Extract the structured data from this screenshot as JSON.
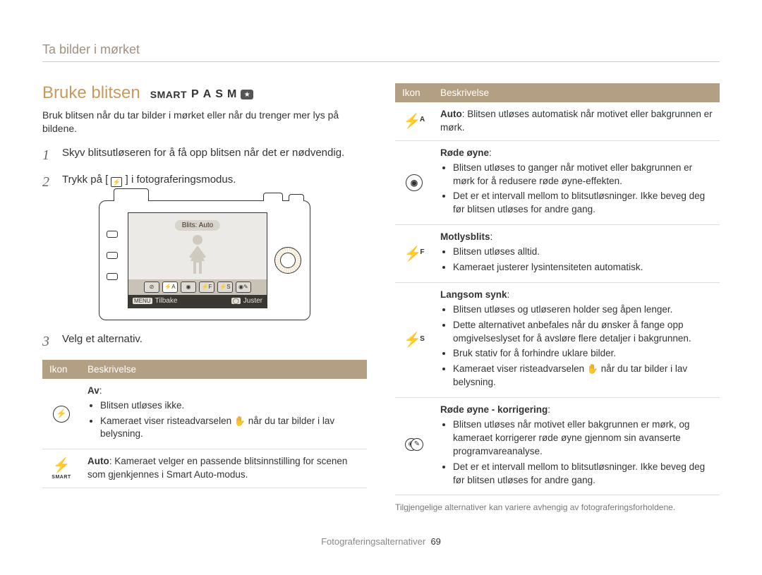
{
  "breadcrumb": "Ta bilder i mørket",
  "heading": "Bruke blitsen",
  "modes": {
    "smart": "SMART",
    "p": "P",
    "a": "A",
    "s": "S",
    "m": "M",
    "star": "★"
  },
  "intro": "Bruk blitsen når du tar bilder i mørket eller når du trenger mer lys på bildene.",
  "steps": {
    "s1": "Skyv blitsutløseren for å få opp blitsen når det er nødvendig.",
    "s2a": "Trykk på [",
    "s2b": "] i fotograferingsmodus.",
    "s3": "Velg et alternativ."
  },
  "inline_flash_glyph": "⚡",
  "camera": {
    "lcd_label": "Blits: Auto",
    "back_label": "Tilbake",
    "adjust_label": "Juster",
    "menu_badge": "MENU"
  },
  "table_left": {
    "h_icon": "Ikon",
    "h_desc": "Beskrivelse",
    "rows": {
      "off": {
        "title": "Av",
        "b1": "Blitsen utløses ikke.",
        "b2a": "Kameraet viser risteadvarselen ",
        "b2b": " når du tar bilder i lav belysning."
      },
      "smart": {
        "title": "Auto",
        "body": ": Kameraet velger en passende blitsinnstilling for scenen som gjenkjennes i Smart Auto-modus.",
        "sub": "SMART"
      }
    }
  },
  "table_right": {
    "h_icon": "Ikon",
    "h_desc": "Beskrivelse",
    "rows": {
      "auto": {
        "title": "Auto",
        "body": ": Blitsen utløses automatisk når motivet eller bakgrunnen er mørk.",
        "sup": "A"
      },
      "redeye": {
        "title": "Røde øyne",
        "b1": "Blitsen utløses to ganger når motivet eller bakgrunnen er mørk for å redusere røde øyne-effekten.",
        "b2": "Det er et intervall mellom to blitsutløsninger. Ikke beveg deg før blitsen utløses for andre gang."
      },
      "fill": {
        "title": "Motlysblits",
        "b1": "Blitsen utløses alltid.",
        "b2": "Kameraet justerer lysintensiteten automatisk.",
        "sup": "F"
      },
      "slow": {
        "title": "Langsom synk",
        "b1": "Blitsen utløses og utløseren holder seg åpen lenger.",
        "b2": "Dette alternativet anbefales når du ønsker å fange opp omgivelseslyset for å avsløre flere detaljer i bakgrunnen.",
        "b3": "Bruk stativ for å forhindre uklare bilder.",
        "b4a": "Kameraet viser risteadvarselen ",
        "b4b": " når du tar bilder i lav belysning.",
        "sup": "S"
      },
      "redeye_fix": {
        "title": "Røde øyne - korrigering",
        "b1": "Blitsen utløses når motivet eller bakgrunnen er mørk, og kameraet korrigerer røde øyne gjennom sin avanserte programvareanalyse.",
        "b2": "Det er et intervall mellom to blitsutløsninger. Ikke beveg deg før blitsen utløses for andre gang."
      }
    }
  },
  "footnote": "Tilgjengelige alternativer kan variere avhengig av fotograferingsforholdene.",
  "footer": {
    "section": "Fotograferingsalternativer",
    "page": "69"
  },
  "glyphs": {
    "hand": "✋",
    "eye": "◉",
    "bolt": "⚡",
    "off": "⊘"
  }
}
